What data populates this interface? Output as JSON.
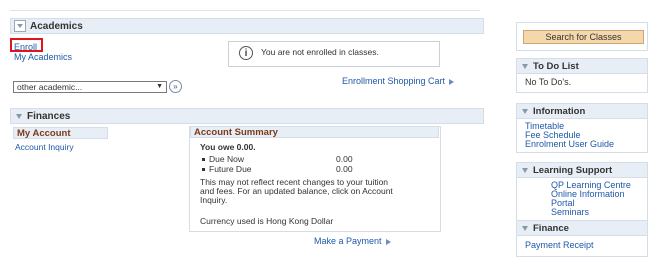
{
  "academics": {
    "title": "Academics",
    "enroll_link": "Enroll",
    "my_academics_link": "My Academics",
    "info_message": "You are not enrolled in classes.",
    "shopping_cart_link": "Enrollment Shopping Cart",
    "other_select_value": "other academic..."
  },
  "finances": {
    "title": "Finances",
    "my_account_tab": "My Account",
    "account_inquiry_link": "Account Inquiry",
    "summary_title": "Account Summary",
    "owe_text": "You owe 0.00.",
    "rows": [
      {
        "label": "Due Now",
        "value": "0.00"
      },
      {
        "label": "Future Due",
        "value": "0.00"
      }
    ],
    "note_lines": [
      "This may not reflect recent changes to your tuition",
      "and fees.  For an updated balance, click on Account",
      "Inquiry."
    ],
    "currency_text": "Currency used is Hong Kong Dollar",
    "make_payment_link": "Make a Payment"
  },
  "right": {
    "search_button": "Search for Classes",
    "todo": {
      "title": "To Do List",
      "empty": "No To Do's."
    },
    "information": {
      "title": "Information",
      "links": [
        "Timetable",
        "Fee Schedule",
        "Enrolment User Guide"
      ]
    },
    "learning_support": {
      "title": "Learning Support",
      "links": [
        "QP Learning Centre",
        "Online Information Portal",
        "Seminars"
      ]
    },
    "finance": {
      "title": "Finance",
      "links": [
        "Payment Receipt"
      ]
    }
  }
}
